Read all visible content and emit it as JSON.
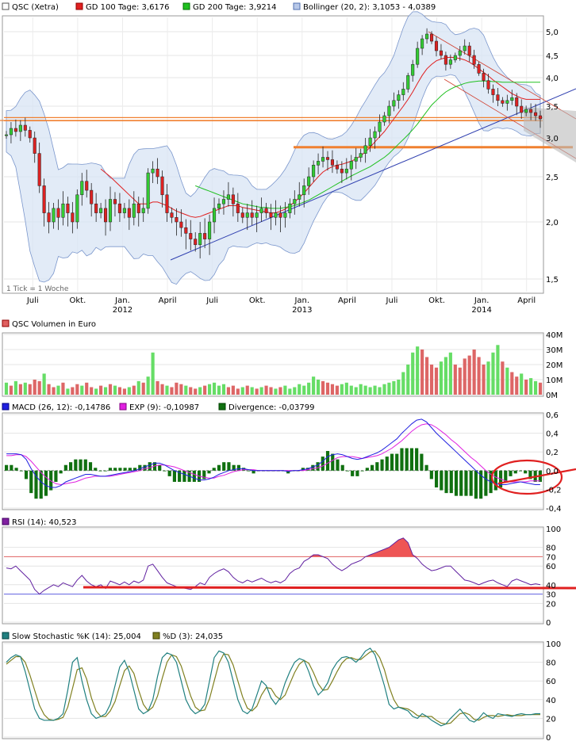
{
  "legends": {
    "main": [
      {
        "text": "QSC (Xetra)",
        "color": "#ffffff",
        "border": "#555555"
      },
      {
        "text": "GD 100 Tage: 3,6176",
        "color": "#e02020",
        "border": "#900000"
      },
      {
        "text": "GD 200 Tage: 3,9214",
        "color": "#20c020",
        "border": "#007000"
      },
      {
        "text": "Bollinger (20, 2): 3,1053 - 4,0389",
        "color": "#b8c8e8",
        "border": "#5070b0"
      }
    ],
    "volume": [
      {
        "text": "QSC Volumen in Euro",
        "color": "#e06060",
        "border": "#900000"
      }
    ],
    "macd": [
      {
        "text": "MACD (26, 12): -0,14786",
        "color": "#2020e0",
        "border": "#000080"
      },
      {
        "text": "EXP (9): -0,10987",
        "color": "#e020e0",
        "border": "#800080"
      },
      {
        "text": "Divergence: -0,03799",
        "color": "#107010",
        "border": "#004000"
      }
    ],
    "rsi": [
      {
        "text": "RSI (14): 40,523",
        "color": "#8020a0",
        "border": "#400060"
      }
    ],
    "stoch": [
      {
        "text": "Slow Stochastic %K (14): 25,004",
        "color": "#208080",
        "border": "#004040"
      },
      {
        "text": "%D (3): 24,035",
        "color": "#808020",
        "border": "#404000"
      }
    ]
  },
  "tick_note": "1 Tick = 1 Woche",
  "chart_data": [
    {
      "type": "candlestick",
      "name": "price",
      "ylim": [
        1.5,
        5.0
      ],
      "y_ticks": [
        "5,0",
        "4,5",
        "4,0",
        "3,5",
        "3,0",
        "2,5",
        "2,0",
        "1,5"
      ],
      "x_ticks": [
        {
          "label": "Juli",
          "sub": ""
        },
        {
          "label": "Okt.",
          "sub": ""
        },
        {
          "label": "Jan.",
          "sub": "2012"
        },
        {
          "label": "April",
          "sub": ""
        },
        {
          "label": "Juli",
          "sub": ""
        },
        {
          "label": "Okt.",
          "sub": ""
        },
        {
          "label": "Jan.",
          "sub": "2013"
        },
        {
          "label": "April",
          "sub": ""
        },
        {
          "label": "Juli",
          "sub": ""
        },
        {
          "label": "Okt.",
          "sub": ""
        },
        {
          "label": "Jan.",
          "sub": "2014"
        },
        {
          "label": "April",
          "sub": ""
        }
      ],
      "close_series": [
        3.05,
        3.15,
        3.1,
        3.2,
        3.12,
        3.0,
        2.8,
        2.4,
        2.1,
        2.0,
        2.15,
        2.05,
        2.2,
        2.1,
        2.0,
        2.3,
        2.45,
        2.35,
        2.2,
        2.1,
        2.15,
        2.0,
        2.25,
        2.2,
        2.1,
        2.15,
        2.05,
        2.2,
        2.1,
        2.15,
        2.55,
        2.6,
        2.5,
        2.3,
        2.1,
        2.05,
        2.0,
        1.95,
        1.9,
        1.85,
        1.8,
        1.9,
        1.85,
        2.0,
        2.15,
        2.2,
        2.25,
        2.3,
        2.2,
        2.1,
        2.05,
        2.1,
        2.05,
        2.1,
        2.15,
        2.1,
        2.05,
        2.1,
        2.05,
        2.1,
        2.2,
        2.25,
        2.3,
        2.4,
        2.5,
        2.65,
        2.7,
        2.75,
        2.72,
        2.65,
        2.6,
        2.55,
        2.6,
        2.7,
        2.75,
        2.8,
        2.9,
        3.0,
        3.1,
        3.25,
        3.35,
        3.5,
        3.6,
        3.7,
        3.8,
        4.05,
        4.3,
        4.65,
        4.85,
        4.95,
        4.8,
        4.6,
        4.5,
        4.3,
        4.4,
        4.5,
        4.6,
        4.7,
        4.5,
        4.3,
        4.1,
        3.95,
        3.8,
        3.7,
        3.6,
        3.55,
        3.6,
        3.65,
        3.5,
        3.4,
        3.45,
        3.4,
        3.35,
        3.3
      ],
      "ma100_series": [
        null,
        null,
        null,
        null,
        null,
        null,
        null,
        null,
        null,
        null,
        null,
        null,
        null,
        null,
        null,
        null,
        null,
        null,
        null,
        null,
        2.6,
        2.55,
        2.5,
        2.45,
        2.4,
        2.35,
        2.3,
        2.25,
        2.2,
        2.2,
        2.2,
        2.22,
        2.22,
        2.2,
        2.18,
        2.15,
        2.12,
        2.1,
        2.08,
        2.06,
        2.05,
        2.06,
        2.08,
        2.1,
        2.12,
        2.14,
        2.16,
        2.18,
        2.18,
        2.18,
        2.16,
        2.15,
        2.14,
        2.13,
        2.12,
        2.11,
        2.1,
        2.1,
        2.12,
        2.14,
        2.18,
        2.22,
        2.27,
        2.32,
        2.38,
        2.44,
        2.5,
        2.56,
        2.6,
        2.63,
        2.65,
        2.66,
        2.68,
        2.7,
        2.73,
        2.77,
        2.82,
        2.88,
        2.95,
        3.02,
        3.1,
        3.2,
        3.3,
        3.4,
        3.5,
        3.62,
        3.75,
        3.9,
        4.05,
        4.2,
        4.3,
        4.38,
        4.42,
        4.45,
        4.46,
        4.45,
        4.43,
        4.4,
        4.35,
        4.28,
        4.2,
        4.12,
        4.04,
        3.96,
        3.9,
        3.84,
        3.78,
        3.72,
        3.68,
        3.64,
        3.62,
        3.62,
        3.62,
        3.62
      ],
      "ma200_series": [
        null,
        null,
        null,
        null,
        null,
        null,
        null,
        null,
        null,
        null,
        null,
        null,
        null,
        null,
        null,
        null,
        null,
        null,
        null,
        null,
        null,
        null,
        null,
        null,
        null,
        null,
        null,
        null,
        null,
        null,
        null,
        null,
        null,
        null,
        null,
        null,
        null,
        null,
        null,
        null,
        2.4,
        2.38,
        2.36,
        2.34,
        2.32,
        2.3,
        2.28,
        2.26,
        2.24,
        2.22,
        2.2,
        2.19,
        2.18,
        2.17,
        2.16,
        2.16,
        2.15,
        2.15,
        2.15,
        2.16,
        2.17,
        2.18,
        2.2,
        2.22,
        2.24,
        2.27,
        2.3,
        2.33,
        2.36,
        2.39,
        2.42,
        2.45,
        2.48,
        2.51,
        2.54,
        2.57,
        2.6,
        2.63,
        2.67,
        2.71,
        2.75,
        2.8,
        2.86,
        2.92,
        2.98,
        3.05,
        3.13,
        3.22,
        3.32,
        3.42,
        3.52,
        3.6,
        3.68,
        3.75,
        3.8,
        3.84,
        3.87,
        3.9,
        3.92,
        3.93,
        3.94,
        3.94,
        3.94,
        3.93,
        3.93,
        3.92,
        3.92,
        3.92,
        3.92,
        3.92,
        3.92,
        3.92,
        3.92,
        3.92
      ]
    },
    {
      "type": "bar",
      "name": "volume",
      "ylim": [
        0,
        40
      ],
      "y_ticks": [
        "40M",
        "30M",
        "20M",
        "10M",
        "0M"
      ],
      "values": [
        8,
        6,
        9,
        7,
        8,
        7,
        10,
        9,
        14,
        7,
        5,
        6,
        8,
        4,
        5,
        7,
        6,
        8,
        5,
        4,
        6,
        5,
        7,
        6,
        5,
        4,
        5,
        6,
        9,
        8,
        12,
        28,
        9,
        7,
        6,
        5,
        8,
        7,
        6,
        5,
        4,
        5,
        6,
        7,
        8,
        6,
        7,
        5,
        6,
        4,
        5,
        6,
        5,
        4,
        5,
        6,
        5,
        4,
        5,
        6,
        4,
        5,
        7,
        6,
        8,
        12,
        10,
        9,
        8,
        7,
        6,
        7,
        8,
        6,
        5,
        7,
        6,
        5,
        6,
        5,
        7,
        8,
        9,
        10,
        15,
        20,
        28,
        32,
        30,
        25,
        20,
        18,
        22,
        25,
        28,
        20,
        18,
        24,
        26,
        30,
        25,
        20,
        22,
        28,
        33,
        22,
        18,
        15,
        12,
        14,
        10,
        11,
        9,
        8
      ],
      "up": [
        1,
        0,
        1,
        0,
        1,
        0,
        0,
        0,
        1,
        0,
        0,
        1,
        0,
        1,
        0,
        0,
        1,
        0,
        0,
        1,
        0,
        1,
        0,
        1,
        0,
        0,
        1,
        0,
        1,
        0,
        1,
        1,
        0,
        0,
        1,
        0,
        0,
        0,
        1,
        0,
        0,
        1,
        0,
        1,
        1,
        1,
        1,
        0,
        0,
        0,
        1,
        0,
        1,
        0,
        1,
        0,
        0,
        1,
        0,
        1,
        1,
        1,
        1,
        1,
        1,
        1,
        1,
        0,
        0,
        0,
        0,
        1,
        1,
        1,
        1,
        1,
        1,
        1,
        1,
        1,
        1,
        1,
        1,
        1,
        1,
        1,
        1,
        1,
        0,
        0,
        0,
        0,
        1,
        1,
        1,
        0,
        0,
        0,
        0,
        0,
        0,
        0,
        1,
        1,
        1,
        0,
        1,
        0,
        0,
        1,
        0,
        1,
        1,
        0
      ]
    },
    {
      "type": "line",
      "name": "macd",
      "ylim": [
        -0.4,
        0.6
      ],
      "y_ticks": [
        "0,6",
        "0,4",
        "0,2",
        "0,0",
        "-0,2",
        "-0,4"
      ],
      "macd": [
        0.18,
        0.18,
        0.18,
        0.17,
        0.12,
        0.02,
        -0.06,
        -0.12,
        -0.16,
        -0.18,
        -0.18,
        -0.16,
        -0.12,
        -0.1,
        -0.08,
        -0.06,
        -0.04,
        -0.04,
        -0.05,
        -0.06,
        -0.06,
        -0.05,
        -0.04,
        -0.03,
        -0.02,
        -0.01,
        0.0,
        0.02,
        0.04,
        0.06,
        0.08,
        0.08,
        0.06,
        0.03,
        0.0,
        -0.02,
        -0.04,
        -0.06,
        -0.08,
        -0.1,
        -0.1,
        -0.09,
        -0.07,
        -0.04,
        -0.02,
        0.0,
        0.01,
        0.02,
        0.02,
        0.01,
        0.0,
        0.0,
        0.0,
        0.0,
        0.0,
        0.0,
        0.0,
        -0.01,
        0.0,
        0.0,
        0.01,
        0.02,
        0.04,
        0.06,
        0.1,
        0.15,
        0.17,
        0.18,
        0.17,
        0.15,
        0.13,
        0.12,
        0.13,
        0.15,
        0.17,
        0.19,
        0.22,
        0.26,
        0.3,
        0.34,
        0.4,
        0.45,
        0.5,
        0.54,
        0.55,
        0.52,
        0.46,
        0.4,
        0.35,
        0.3,
        0.25,
        0.2,
        0.15,
        0.1,
        0.05,
        0.0,
        -0.05,
        -0.09,
        -0.12,
        -0.14,
        -0.15,
        -0.15,
        -0.14,
        -0.13,
        -0.12,
        -0.13,
        -0.14,
        -0.15,
        -0.15
      ],
      "signal": [
        0.16,
        0.16,
        0.17,
        0.17,
        0.15,
        0.1,
        0.04,
        -0.02,
        -0.07,
        -0.11,
        -0.14,
        -0.15,
        -0.14,
        -0.13,
        -0.12,
        -0.1,
        -0.08,
        -0.07,
        -0.06,
        -0.06,
        -0.06,
        -0.06,
        -0.05,
        -0.04,
        -0.03,
        -0.02,
        -0.01,
        0.0,
        0.02,
        0.03,
        0.05,
        0.06,
        0.06,
        0.05,
        0.04,
        0.02,
        0.0,
        -0.02,
        -0.04,
        -0.06,
        -0.07,
        -0.08,
        -0.08,
        -0.06,
        -0.05,
        -0.03,
        -0.01,
        0.0,
        0.01,
        0.01,
        0.01,
        0.0,
        0.0,
        0.0,
        0.0,
        0.0,
        0.0,
        0.0,
        0.0,
        0.0,
        0.0,
        0.01,
        0.02,
        0.03,
        0.05,
        0.08,
        0.11,
        0.14,
        0.15,
        0.15,
        0.15,
        0.14,
        0.13,
        0.14,
        0.15,
        0.16,
        0.18,
        0.21,
        0.24,
        0.28,
        0.32,
        0.37,
        0.42,
        0.46,
        0.49,
        0.5,
        0.49,
        0.46,
        0.42,
        0.38,
        0.33,
        0.29,
        0.24,
        0.19,
        0.14,
        0.1,
        0.05,
        0.0,
        -0.04,
        -0.07,
        -0.09,
        -0.11,
        -0.12,
        -0.12,
        -0.12,
        -0.12,
        -0.11,
        -0.11,
        -0.11
      ]
    },
    {
      "type": "line",
      "name": "rsi",
      "ylim": [
        0,
        100
      ],
      "y_ticks": [
        "100",
        "80",
        "70",
        "60",
        "40",
        "30",
        "20",
        "0"
      ],
      "values": [
        58,
        57,
        60,
        55,
        50,
        45,
        35,
        30,
        34,
        37,
        40,
        38,
        42,
        40,
        38,
        45,
        50,
        44,
        40,
        38,
        40,
        36,
        44,
        42,
        40,
        43,
        40,
        44,
        42,
        45,
        60,
        62,
        55,
        48,
        42,
        40,
        38,
        37,
        36,
        35,
        38,
        42,
        40,
        48,
        52,
        55,
        57,
        54,
        48,
        44,
        42,
        45,
        43,
        45,
        47,
        44,
        42,
        44,
        42,
        45,
        52,
        56,
        58,
        65,
        68,
        72,
        72,
        70,
        68,
        62,
        58,
        55,
        58,
        62,
        64,
        66,
        70,
        72,
        74,
        76,
        78,
        80,
        84,
        88,
        90,
        85,
        72,
        68,
        62,
        58,
        55,
        56,
        58,
        60,
        60,
        55,
        50,
        45,
        44,
        42,
        40,
        42,
        44,
        45,
        42,
        40,
        38,
        44,
        46,
        44,
        42,
        40,
        41,
        40
      ]
    },
    {
      "type": "line",
      "name": "stoch",
      "ylim": [
        0,
        100
      ],
      "y_ticks": [
        "100",
        "80",
        "60",
        "40",
        "20",
        "0"
      ],
      "k": [
        80,
        85,
        88,
        86,
        70,
        50,
        30,
        20,
        18,
        18,
        18,
        20,
        25,
        50,
        80,
        85,
        60,
        40,
        25,
        20,
        22,
        25,
        35,
        55,
        75,
        82,
        70,
        50,
        30,
        25,
        28,
        40,
        65,
        85,
        90,
        88,
        80,
        60,
        40,
        30,
        25,
        28,
        35,
        60,
        85,
        92,
        90,
        80,
        60,
        40,
        28,
        25,
        30,
        45,
        60,
        55,
        42,
        35,
        42,
        58,
        70,
        80,
        84,
        82,
        70,
        55,
        45,
        50,
        58,
        72,
        80,
        85,
        86,
        84,
        80,
        85,
        92,
        95,
        88,
        72,
        55,
        35,
        30,
        32,
        30,
        28,
        22,
        20,
        25,
        22,
        18,
        15,
        12,
        14,
        20,
        25,
        30,
        24,
        18,
        16,
        20,
        26,
        22,
        20,
        25,
        24,
        23,
        22,
        24,
        25,
        24,
        24,
        25,
        25
      ],
      "d": [
        78,
        82,
        86,
        86,
        80,
        66,
        50,
        34,
        24,
        19,
        18,
        19,
        21,
        32,
        52,
        72,
        74,
        62,
        42,
        28,
        22,
        22,
        28,
        38,
        55,
        71,
        76,
        68,
        50,
        35,
        28,
        32,
        44,
        63,
        80,
        88,
        86,
        76,
        60,
        44,
        32,
        28,
        29,
        41,
        60,
        79,
        89,
        88,
        77,
        60,
        43,
        31,
        28,
        33,
        45,
        53,
        52,
        44,
        40,
        45,
        57,
        69,
        78,
        82,
        79,
        69,
        57,
        50,
        51,
        60,
        70,
        79,
        84,
        85,
        83,
        83,
        87,
        91,
        92,
        85,
        72,
        54,
        40,
        32,
        31,
        30,
        27,
        23,
        22,
        22,
        22,
        18,
        15,
        14,
        15,
        20,
        25,
        26,
        24,
        19,
        18,
        21,
        23,
        23,
        22,
        23,
        24,
        23,
        23,
        23,
        24,
        24,
        24,
        24
      ]
    }
  ]
}
